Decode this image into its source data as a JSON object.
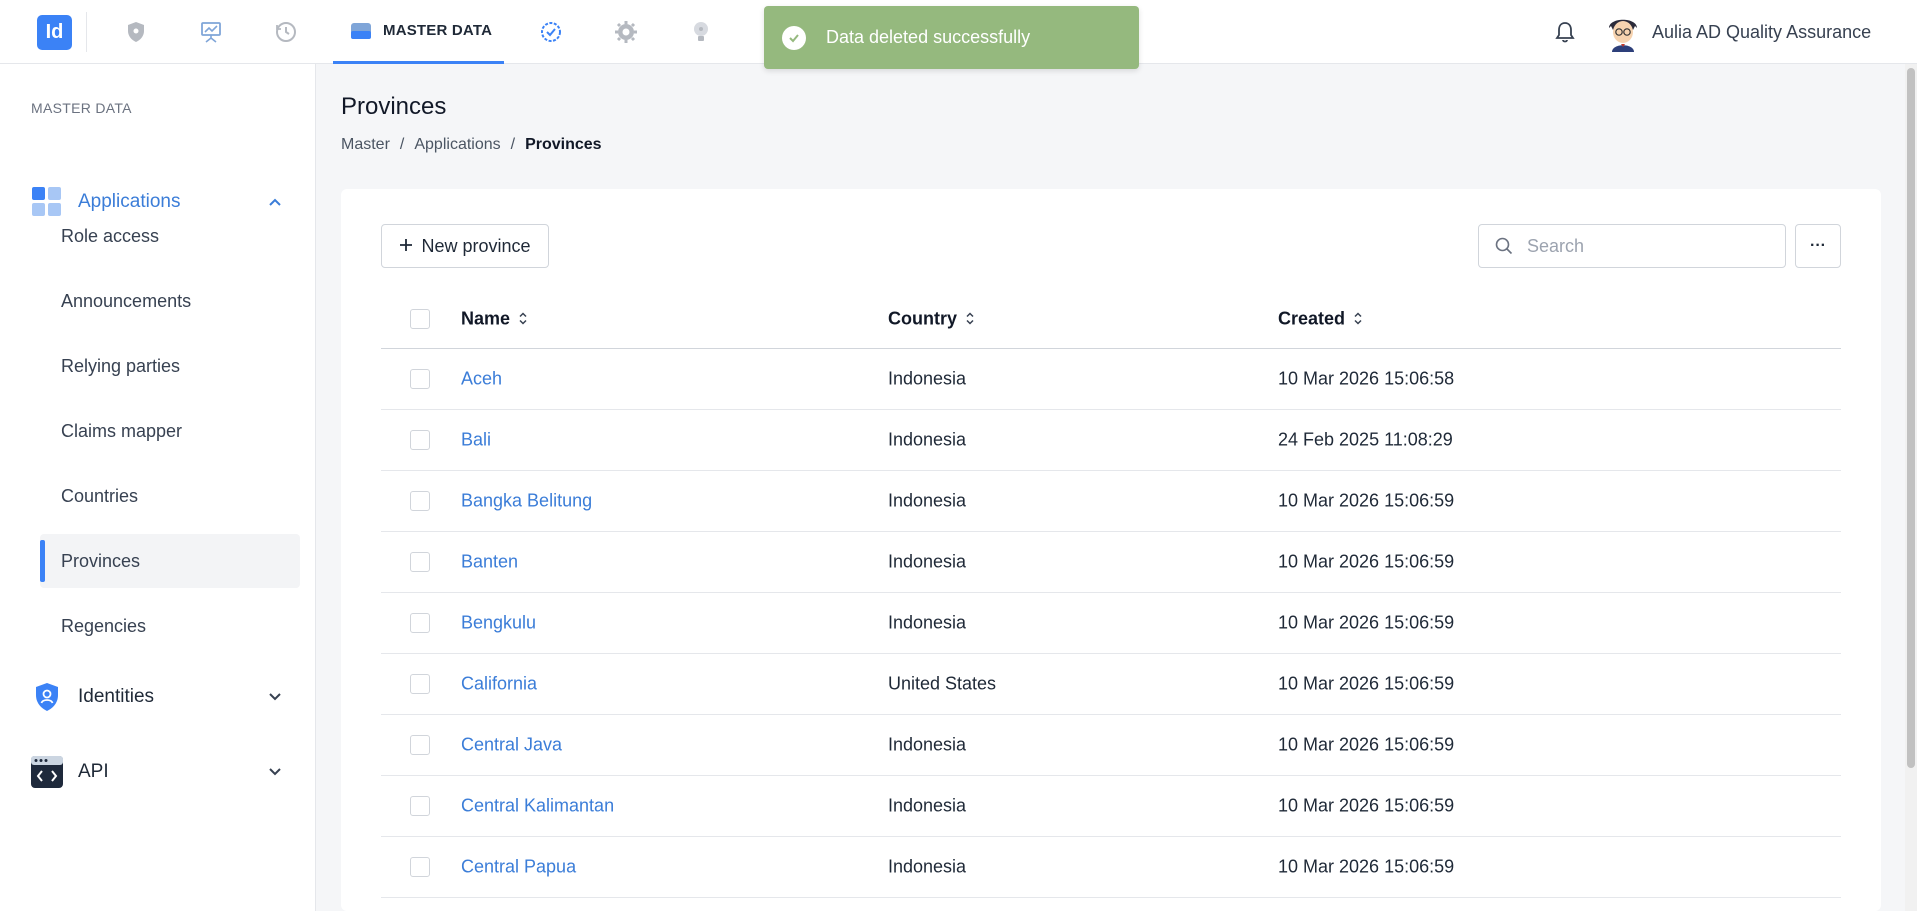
{
  "topbar": {
    "logo_text": "Id",
    "active_tab_label": "MASTER DATA",
    "nav_icons": [
      "shield-icon",
      "presentation-icon",
      "history-icon",
      "checklist-badge-icon",
      "gear-icon",
      "lightbulb-icon"
    ],
    "user_name": "Aulia AD Quality Assurance"
  },
  "toast": {
    "message": "Data deleted successfully",
    "color": "#95b97e"
  },
  "sidebar": {
    "heading": "MASTER DATA",
    "groups": [
      {
        "label": "Applications",
        "expanded": true,
        "items": [
          {
            "label": "Role access"
          },
          {
            "label": "Announcements"
          },
          {
            "label": "Relying parties"
          },
          {
            "label": "Claims mapper"
          },
          {
            "label": "Countries"
          },
          {
            "label": "Provinces",
            "active": true
          },
          {
            "label": "Regencies"
          }
        ]
      },
      {
        "label": "Identities",
        "expanded": false
      },
      {
        "label": "API",
        "expanded": false
      }
    ]
  },
  "page": {
    "title": "Provinces",
    "breadcrumb": [
      "Master",
      "Applications",
      "Provinces"
    ],
    "separator": "/"
  },
  "toolbar": {
    "new_button_label": "New province",
    "search_placeholder": "Search",
    "more_label": "···"
  },
  "table": {
    "columns": [
      "Name",
      "Country",
      "Created"
    ],
    "rows": [
      {
        "name": "Aceh",
        "country": "Indonesia",
        "created": "10 Mar 2026 15:06:58"
      },
      {
        "name": "Bali",
        "country": "Indonesia",
        "created": "24 Feb 2025 11:08:29"
      },
      {
        "name": "Bangka Belitung",
        "country": "Indonesia",
        "created": "10 Mar 2026 15:06:59"
      },
      {
        "name": "Banten",
        "country": "Indonesia",
        "created": "10 Mar 2026 15:06:59"
      },
      {
        "name": "Bengkulu",
        "country": "Indonesia",
        "created": "10 Mar 2026 15:06:59"
      },
      {
        "name": "California",
        "country": "United States",
        "created": "10 Mar 2026 15:06:59"
      },
      {
        "name": "Central Java",
        "country": "Indonesia",
        "created": "10 Mar 2026 15:06:59"
      },
      {
        "name": "Central Kalimantan",
        "country": "Indonesia",
        "created": "10 Mar 2026 15:06:59"
      },
      {
        "name": "Central Papua",
        "country": "Indonesia",
        "created": "10 Mar 2026 15:06:59"
      }
    ]
  },
  "colors": {
    "accent": "#3b82f6",
    "link": "#3b7dd8"
  }
}
